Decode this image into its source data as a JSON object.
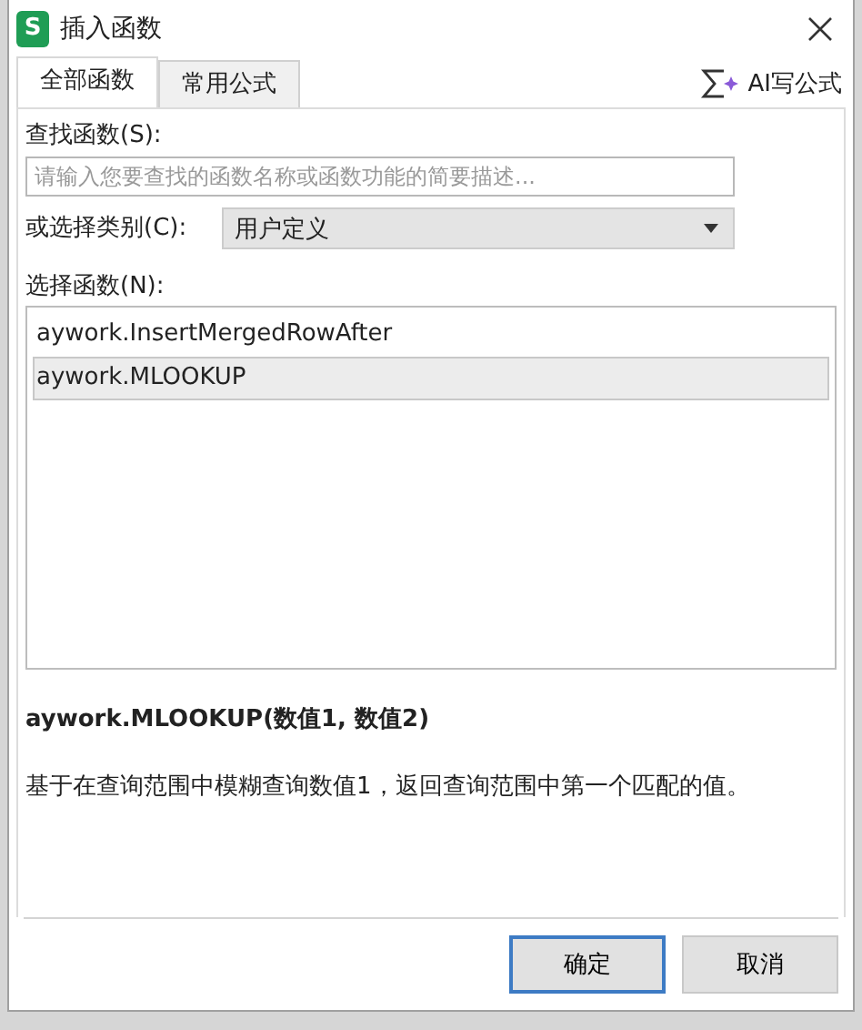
{
  "window": {
    "title": "插入函数",
    "app_icon": "S"
  },
  "tabs": [
    {
      "label": "全部函数",
      "selected": true
    },
    {
      "label": "常用公式",
      "selected": false
    }
  ],
  "ai_button": {
    "label": "AI写公式"
  },
  "search": {
    "label": "查找函数(S):",
    "placeholder": "请输入您要查找的函数名称或函数功能的简要描述..."
  },
  "category": {
    "label": "或选择类别(C):",
    "value": "用户定义"
  },
  "function_list": {
    "label": "选择函数(N):",
    "items": [
      {
        "name": "aywork.InsertMergedRowAfter",
        "selected": false
      },
      {
        "name": "aywork.MLOOKUP",
        "selected": true
      }
    ]
  },
  "signature": "aywork.MLOOKUP(数值1, 数值2)",
  "description": "基于在查询范围中模糊查询数值1，返回查询范围中第一个匹配的值。",
  "buttons": [
    {
      "label": "确定",
      "default": true
    },
    {
      "label": "取消",
      "default": false
    }
  ]
}
